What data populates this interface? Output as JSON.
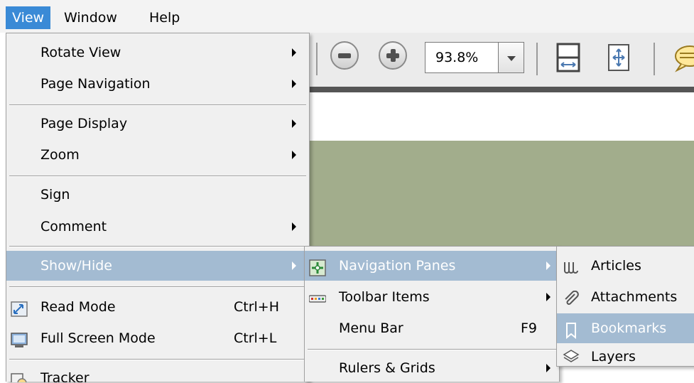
{
  "menubar": {
    "items": [
      {
        "label": "View",
        "active": true
      },
      {
        "label": "Window",
        "active": false
      },
      {
        "label": "Help",
        "active": false
      }
    ]
  },
  "toolbar": {
    "zoom_value": "93.8%",
    "icons": [
      "zoom-out-icon",
      "zoom-in-icon",
      "zoom-dropdown-icon",
      "fit-width-icon",
      "fit-page-icon",
      "comment-icon"
    ]
  },
  "view_menu": {
    "items": [
      {
        "label": "Rotate View",
        "submenu": true
      },
      {
        "label": "Page Navigation",
        "submenu": true
      },
      {
        "label": "Page Display",
        "submenu": true
      },
      {
        "label": "Zoom",
        "submenu": true
      },
      {
        "label": "Sign",
        "submenu": false
      },
      {
        "label": "Comment",
        "submenu": true
      },
      {
        "label": "Show/Hide",
        "submenu": true,
        "highlighted": true
      },
      {
        "label": "Read Mode",
        "shortcut": "Ctrl+H",
        "icon": "read-mode-icon"
      },
      {
        "label": "Full Screen Mode",
        "shortcut": "Ctrl+L",
        "icon": "full-screen-icon"
      },
      {
        "label": "Tracker",
        "icon": "tracker-icon"
      }
    ]
  },
  "showhide_menu": {
    "items": [
      {
        "label": "Navigation Panes",
        "submenu": true,
        "highlighted": true,
        "icon": "navigation-panes-icon"
      },
      {
        "label": "Toolbar Items",
        "submenu": true,
        "icon": "toolbar-items-icon"
      },
      {
        "label": "Menu Bar",
        "shortcut": "F9"
      },
      {
        "label": "Rulers & Grids",
        "submenu": true
      }
    ]
  },
  "navpanes_menu": {
    "items": [
      {
        "label": "Articles",
        "icon": "articles-icon"
      },
      {
        "label": "Attachments",
        "icon": "attachments-icon"
      },
      {
        "label": "Bookmarks",
        "icon": "bookmarks-icon",
        "highlighted": true
      },
      {
        "label": "Layers",
        "icon": "layers-icon"
      }
    ]
  },
  "colors": {
    "menu_active": "#3a8ad6",
    "menu_highlight": "#a3bbd2",
    "menu_bg": "#f0f0f0",
    "doc_background": "#a2ad8c"
  }
}
